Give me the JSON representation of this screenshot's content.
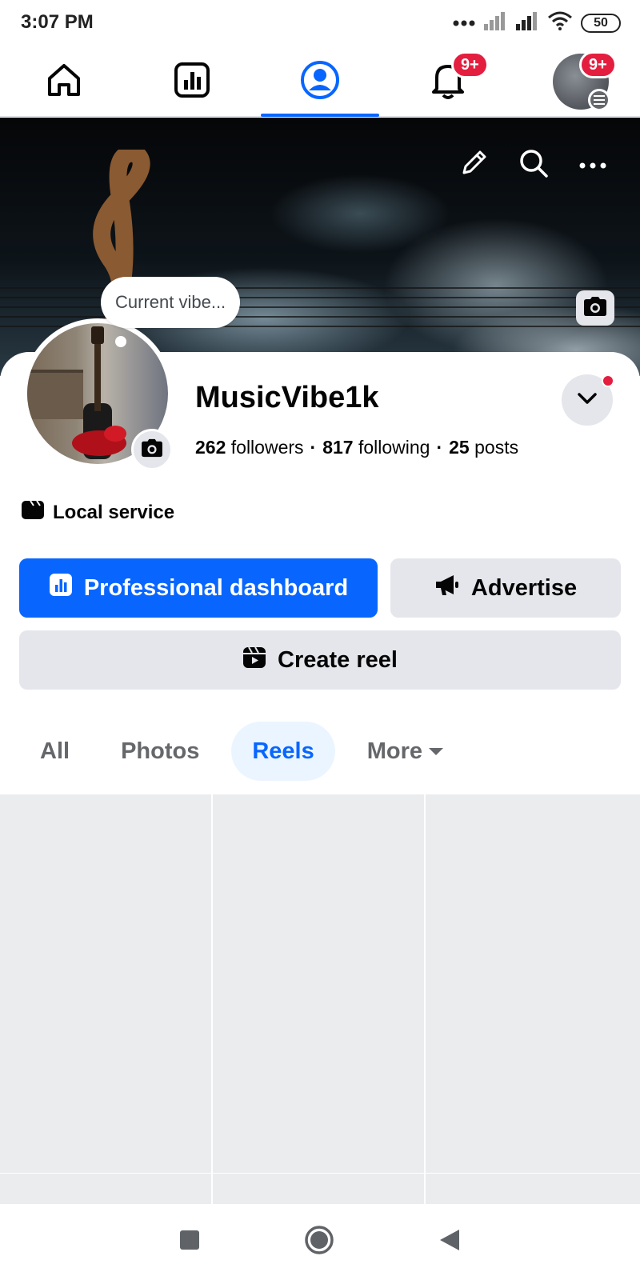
{
  "status_bar": {
    "time": "3:07 PM",
    "battery": "50"
  },
  "top_nav": {
    "notifications_badge": "9+",
    "menu_badge": "9+",
    "active_tab": "profile"
  },
  "cover": {},
  "profile": {
    "thought_bubble": "Current vibe...",
    "name": "MusicVibe1k",
    "followers_count": "262",
    "followers_label": "followers",
    "following_count": "817",
    "following_label": "following",
    "posts_count": "25",
    "posts_label": "posts",
    "category": "Local service"
  },
  "actions": {
    "professional_dashboard": "Professional dashboard",
    "advertise": "Advertise",
    "create_reel": "Create reel"
  },
  "tabs": [
    {
      "label": "All"
    },
    {
      "label": "Photos"
    },
    {
      "label": "Reels"
    },
    {
      "label": "More"
    }
  ],
  "colors": {
    "accent": "#0866ff",
    "badge": "#e41e3f",
    "surface": "#e4e6eb"
  }
}
